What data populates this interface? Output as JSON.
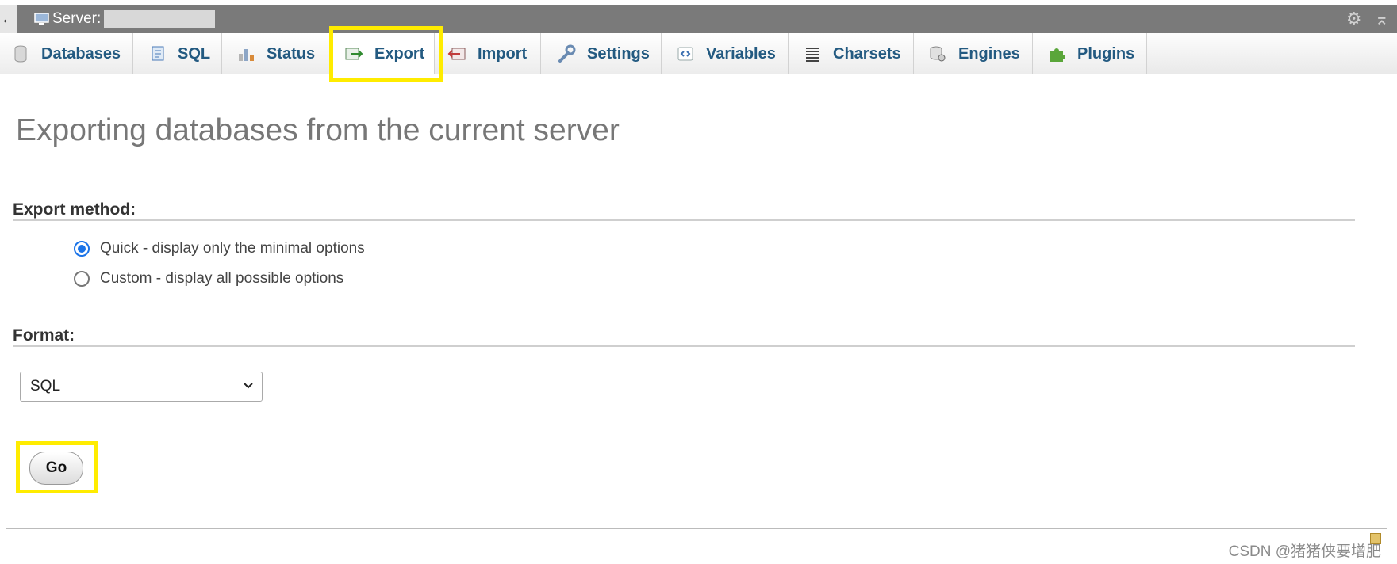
{
  "topbar": {
    "back_icon": "back-arrow-icon",
    "server_label": "Server:",
    "settings_icon": "gear-icon",
    "collapse_icon": "collapse-icon"
  },
  "tabs": [
    {
      "label": "Databases",
      "icon": "database-icon"
    },
    {
      "label": "SQL",
      "icon": "sql-icon"
    },
    {
      "label": "Status",
      "icon": "status-icon"
    },
    {
      "label": "Export",
      "icon": "export-icon",
      "active": true
    },
    {
      "label": "Import",
      "icon": "import-icon"
    },
    {
      "label": "Settings",
      "icon": "wrench-icon"
    },
    {
      "label": "Variables",
      "icon": "variables-icon"
    },
    {
      "label": "Charsets",
      "icon": "charsets-icon"
    },
    {
      "label": "Engines",
      "icon": "engines-icon"
    },
    {
      "label": "Plugins",
      "icon": "puzzle-icon"
    }
  ],
  "main": {
    "title": "Exporting databases from the current server",
    "export_method": {
      "label": "Export method:",
      "options": [
        {
          "label": "Quick - display only the minimal options",
          "checked": true
        },
        {
          "label": "Custom - display all possible options",
          "checked": false
        }
      ]
    },
    "format": {
      "label": "Format:",
      "selected": "SQL"
    },
    "go_label": "Go"
  },
  "highlight_color": "#ffec00",
  "watermark": "CSDN @猪猪侠要增肥"
}
